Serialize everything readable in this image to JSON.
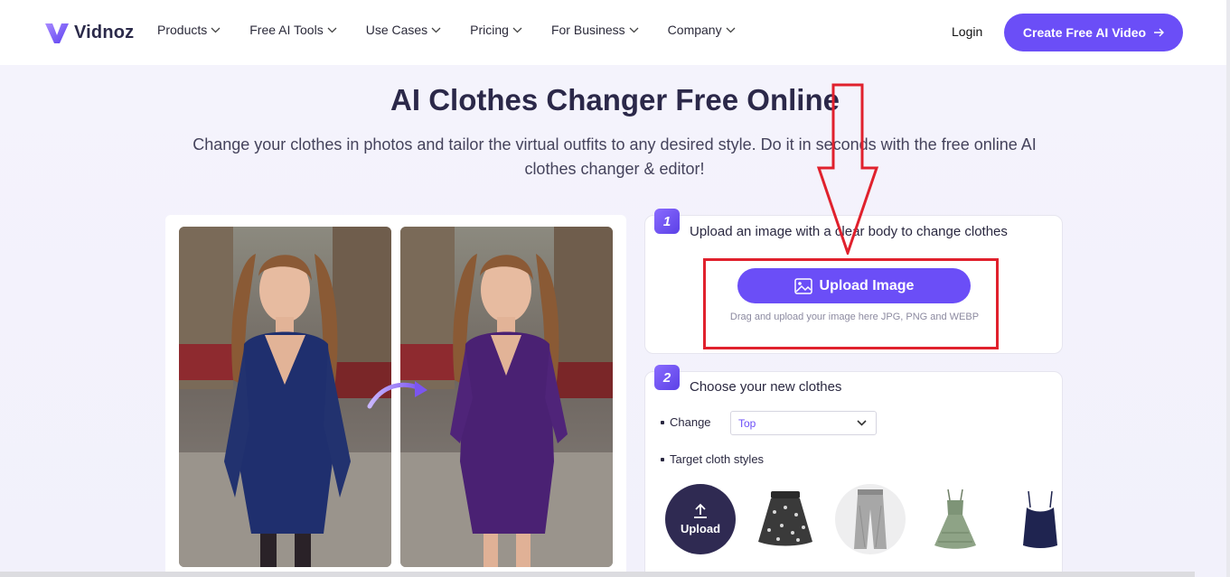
{
  "header": {
    "logo_text": "Vidnoz",
    "nav": [
      {
        "label": "Products"
      },
      {
        "label": "Free AI Tools"
      },
      {
        "label": "Use Cases"
      },
      {
        "label": "Pricing"
      },
      {
        "label": "For Business"
      },
      {
        "label": "Company"
      }
    ],
    "login_label": "Login",
    "cta_label": "Create Free AI Video"
  },
  "hero": {
    "title": "AI Clothes Changer Free Online",
    "subtitle": "Change your clothes in photos and tailor the virtual outfits to any desired style. Do it in seconds with the free online AI clothes changer & editor!"
  },
  "step1": {
    "badge": "1",
    "title": "Upload an image with a clear body to change clothes",
    "upload_label": "Upload Image",
    "hint": "Drag and upload your image here JPG, PNG and WEBP"
  },
  "step2": {
    "badge": "2",
    "title": "Choose your new clothes",
    "change_label": "Change",
    "change_value": "Top",
    "styles_label": "Target cloth styles",
    "upload_style_label": "Upload",
    "styles": [
      "floral-skirt",
      "grey-jeans",
      "green-dress",
      "navy-camisole"
    ]
  },
  "colors": {
    "accent": "#6b4ef7",
    "annotation_red": "#e0212d",
    "before_dress": "#1f2f6e",
    "after_dress": "#4a2173"
  }
}
